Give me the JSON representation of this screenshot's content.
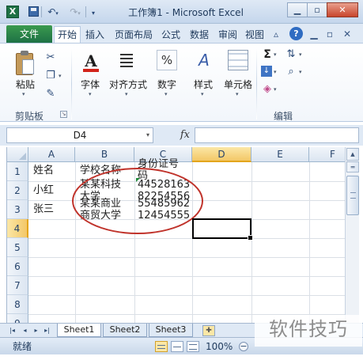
{
  "window": {
    "title": "工作簿1 - Microsoft Excel",
    "app_icon_letter": "X"
  },
  "quick_access": {
    "icons": [
      "save-icon",
      "undo-icon",
      "redo-icon",
      "customize-icon"
    ]
  },
  "ribbon_tabs": [
    "文件",
    "开始",
    "插入",
    "页面布局",
    "公式",
    "数据",
    "审阅",
    "视图"
  ],
  "active_tab": "开始",
  "ribbon": {
    "clipboard": {
      "paste_label": "粘贴",
      "group_label": "剪贴板"
    },
    "font": {
      "label": "字体"
    },
    "alignment": {
      "label": "对齐方式"
    },
    "number": {
      "label": "数字",
      "symbol": "%"
    },
    "styles": {
      "label": "样式"
    },
    "cells": {
      "label": "单元格"
    },
    "editing": {
      "group_label": "编辑",
      "sum_symbol": "Σ"
    }
  },
  "formula_bar": {
    "name_box": "D4",
    "fx": "fx",
    "formula": ""
  },
  "sheet": {
    "columns": [
      "A",
      "B",
      "C",
      "D",
      "E",
      "F"
    ],
    "selected_column": "D",
    "rows": [
      "1",
      "2",
      "3",
      "4",
      "5",
      "6",
      "7",
      "8",
      "9"
    ],
    "selected_row": "4",
    "cells": {
      "A1": "姓名",
      "B1": "学校名称",
      "C1_line1": "身份证号",
      "C1_line2": "码",
      "A2": "小红",
      "A3": "张三",
      "B2_line1": "某某科技",
      "B2_line2": "大学",
      "C2_line1": "44528163",
      "C2_line2": "82254556",
      "B3_line1": "某某商业",
      "B3_line2": "商贸大学",
      "C3_line1": "55485962",
      "C3_line2": "12454555"
    },
    "selected_cell": "D4"
  },
  "sheet_tabs": [
    "Sheet1",
    "Sheet2",
    "Sheet3"
  ],
  "active_sheet": "Sheet1",
  "status_bar": {
    "status": "就绪",
    "zoom": "100%",
    "zoom_minus": "−",
    "zoom_plus": "+"
  },
  "watermark": "软件技巧",
  "colors": {
    "file_tab": "#1e7145",
    "selection_header": "#f3c767",
    "annotation_ellipse": "#c0332b"
  }
}
